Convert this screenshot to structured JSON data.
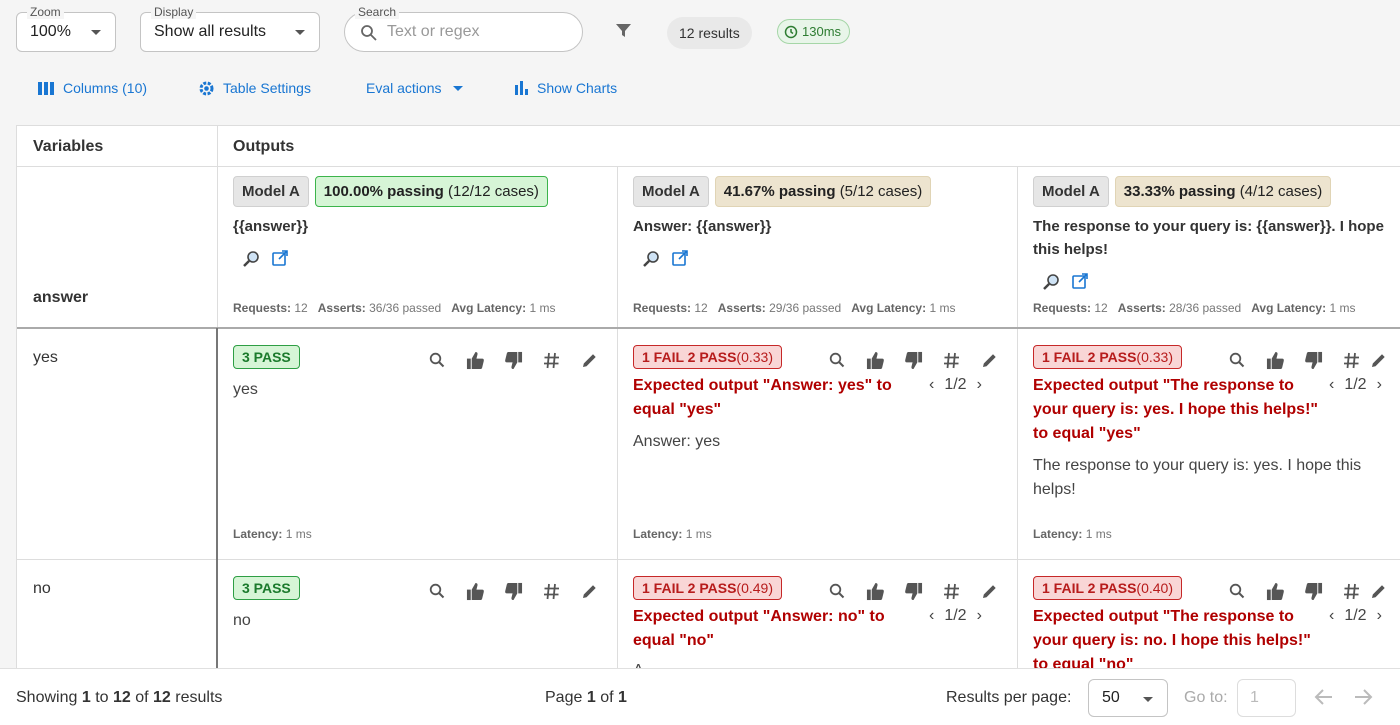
{
  "toolbar": {
    "zoom": {
      "label": "Zoom",
      "value": "100%"
    },
    "display": {
      "label": "Display",
      "value": "Show all results"
    },
    "search": {
      "label": "Search",
      "placeholder": "Text or regex"
    },
    "results_count": "12 results",
    "elapsed": "130ms"
  },
  "actions": {
    "columns": "Columns (10)",
    "table_settings": "Table Settings",
    "eval_actions": "Eval actions",
    "show_charts": "Show Charts"
  },
  "table": {
    "headers": {
      "variables": "Variables",
      "outputs": "Outputs"
    },
    "variable_name": "answer",
    "columns": [
      {
        "provider": "Model A",
        "pass_rate": "100.00% passing",
        "pass_cases": "(12/12 cases)",
        "status": "green",
        "prompt": "{{answer}}",
        "requests_label": "Requests:",
        "requests": "12",
        "asserts_label": "Asserts:",
        "asserts": "36/36 passed",
        "latency_label": "Avg Latency:",
        "latency": "1 ms"
      },
      {
        "provider": "Model A",
        "pass_rate": "41.67% passing",
        "pass_cases": "(5/12 cases)",
        "status": "partial",
        "prompt": "Answer: {{answer}}",
        "requests_label": "Requests:",
        "requests": "12",
        "asserts_label": "Asserts:",
        "asserts": "29/36 passed",
        "latency_label": "Avg Latency:",
        "latency": "1 ms"
      },
      {
        "provider": "Model A",
        "pass_rate": "33.33% passing",
        "pass_cases": "(4/12 cases)",
        "status": "partial",
        "prompt": "The response to your query is: {{answer}}. I hope this helps!",
        "requests_label": "Requests:",
        "requests": "12",
        "asserts_label": "Asserts:",
        "asserts": "28/36 passed",
        "latency_label": "Avg Latency:",
        "latency": "1 ms"
      }
    ],
    "rows": [
      {
        "variable": "yes",
        "cells": [
          {
            "badge": "3 PASS",
            "score": "",
            "output": "yes",
            "latency_label": "Latency:",
            "latency": "1 ms"
          },
          {
            "badge": "1 FAIL 2 PASS",
            "score": "(0.33)",
            "fail": "Expected output \"Answer: yes\" to equal \"yes\"",
            "pager": "1/2",
            "output": "Answer: yes",
            "latency_label": "Latency:",
            "latency": "1 ms"
          },
          {
            "badge": "1 FAIL 2 PASS",
            "score": "(0.33)",
            "fail": "Expected output \"The response to your query is: yes. I hope this helps!\" to equal \"yes\"",
            "pager": "1/2",
            "output": "The response to your query is: yes. I hope this helps!",
            "latency_label": "Latency:",
            "latency": "1 ms"
          }
        ]
      },
      {
        "variable": "no",
        "cells": [
          {
            "badge": "3 PASS",
            "score": "",
            "output": "no"
          },
          {
            "badge": "1 FAIL 2 PASS",
            "score": "(0.49)",
            "fail": "Expected output \"Answer: no\" to equal \"no\"",
            "pager": "1/2",
            "output": "A"
          },
          {
            "badge": "1 FAIL 2 PASS",
            "score": "(0.40)",
            "fail": "Expected output \"The response to your query is: no. I hope this helps!\" to equal \"no\"",
            "pager": "1/2"
          }
        ]
      }
    ]
  },
  "footer": {
    "showing_prefix": "Showing",
    "from": "1",
    "to_word": "to",
    "to": "12",
    "of_word": "of",
    "total": "12",
    "results_word": "results",
    "page_word": "Page",
    "page": "1",
    "page_of": "of",
    "pages": "1",
    "per_page_label": "Results per page:",
    "per_page": "50",
    "goto_label": "Go to:",
    "goto_value": "1"
  },
  "colors": {
    "accent": "#1976d2",
    "pass": "#2e9e44",
    "fail": "#b00000"
  }
}
